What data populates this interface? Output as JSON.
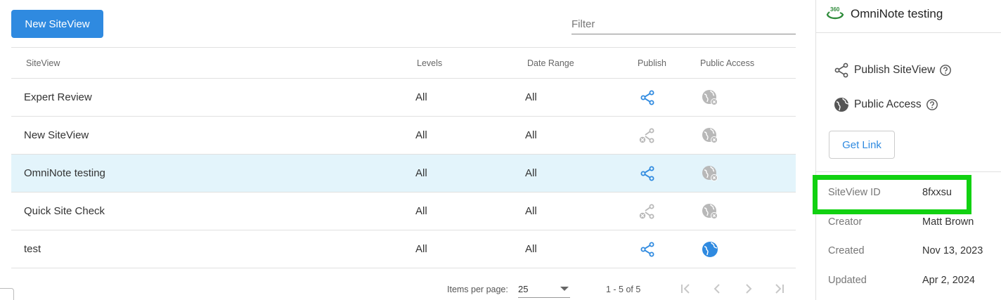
{
  "toolbar": {
    "new_button_label": "New SiteView",
    "filter_placeholder": "Filter"
  },
  "table": {
    "headers": {
      "siteview": "SiteView",
      "levels": "Levels",
      "date_range": "Date Range",
      "publish": "Publish",
      "public_access": "Public Access"
    },
    "rows": [
      {
        "name": "Expert Review",
        "levels": "All",
        "date_range": "All",
        "publish_icon": "share-icon-active",
        "access_icon": "globe-off-icon",
        "selected": false
      },
      {
        "name": "New SiteView",
        "levels": "All",
        "date_range": "All",
        "publish_icon": "share-off-icon",
        "access_icon": "globe-off-icon",
        "selected": false
      },
      {
        "name": "OmniNote testing",
        "levels": "All",
        "date_range": "All",
        "publish_icon": "share-icon-active",
        "access_icon": "globe-off-icon",
        "selected": true
      },
      {
        "name": "Quick Site Check",
        "levels": "All",
        "date_range": "All",
        "publish_icon": "share-off-icon",
        "access_icon": "globe-off-icon",
        "selected": false
      },
      {
        "name": "test",
        "levels": "All",
        "date_range": "All",
        "publish_icon": "share-icon-active",
        "access_icon": "globe-icon-active",
        "selected": false
      }
    ]
  },
  "pager": {
    "items_per_page_label": "Items per page:",
    "items_per_page_value": "25",
    "range_text": "1 - 5 of 5"
  },
  "side": {
    "title": "OmniNote testing",
    "logo_text": "360",
    "publish_label": "Publish SiteView",
    "access_label": "Public Access",
    "get_link_label": "Get Link",
    "meta": {
      "id_label": "SiteView ID",
      "id_value": "8fxxsu",
      "creator_label": "Creator",
      "creator_value": "Matt Brown",
      "created_label": "Created",
      "created_value": "Nov 13, 2023",
      "updated_label": "Updated",
      "updated_value": "Apr 2, 2024"
    }
  },
  "colors": {
    "accent": "#2f8ae0",
    "selected_row": "#e3f4fb",
    "highlight": "#11d111",
    "disabled_icon": "#b8b8b8",
    "logo_green": "#2e8b3a"
  }
}
